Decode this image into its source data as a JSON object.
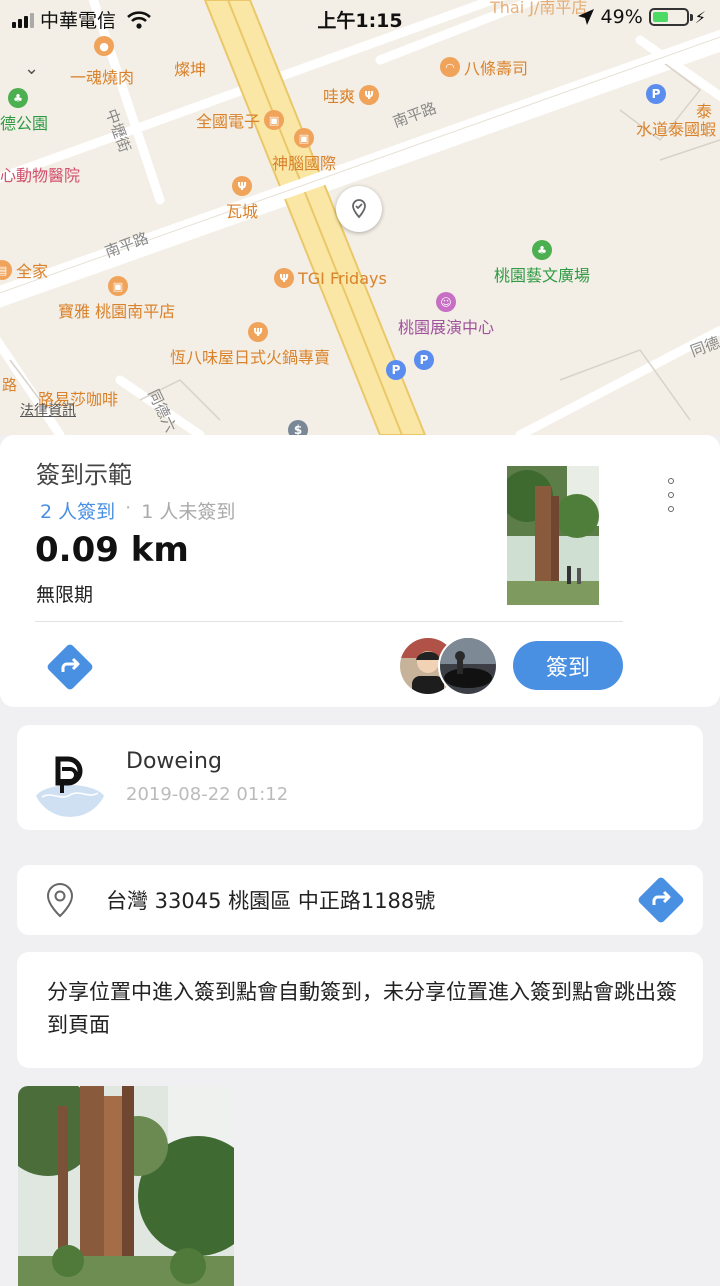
{
  "status_bar": {
    "carrier": "中華電信",
    "time": "上午1:15",
    "battery": "49%",
    "battery_level": 0.49
  },
  "map": {
    "pois": [
      {
        "name": "一魂燒肉",
        "color": "orange"
      },
      {
        "name": "燦坤",
        "color": "orange"
      },
      {
        "name": "八條壽司",
        "color": "orange"
      },
      {
        "name": "哇爽",
        "color": "orange"
      },
      {
        "name": "德公園",
        "color": "green"
      },
      {
        "name": "全國電子",
        "color": "orange"
      },
      {
        "name": "神腦國際",
        "color": "orange"
      },
      {
        "name": "心動物醫院",
        "color": "pink"
      },
      {
        "name": "瓦城",
        "color": "orange"
      },
      {
        "name": "全家",
        "color": "orange"
      },
      {
        "name": "TGI Fridays",
        "color": "orange"
      },
      {
        "name": "桃園藝文廣場",
        "color": "green"
      },
      {
        "name": "寶雅 桃園南平店",
        "color": "orange"
      },
      {
        "name": "桃園展演中心",
        "color": "purple"
      },
      {
        "name": "恆八味屋日式火鍋專賣",
        "color": "orange"
      },
      {
        "name": "路易莎咖啡",
        "color": "orange"
      },
      {
        "name": "水道泰國蝦",
        "color": "orange"
      },
      {
        "name": "泰",
        "color": "orange"
      },
      {
        "name": "Thai J/南平店",
        "color": "orange"
      }
    ],
    "roads": [
      "南平路",
      "南平路",
      "中壢街",
      "同德",
      "同德六",
      "路"
    ],
    "legal_label": "法律資訊"
  },
  "event": {
    "title": "簽到示範",
    "checked_in": "2 人簽到",
    "separator": "·",
    "not_checked_in": "1 人未簽到",
    "distance": "0.09 km",
    "validity": "無限期",
    "checkin_button": "簽到"
  },
  "creator": {
    "name": "Doweing",
    "timestamp": "2019-08-22 01:12"
  },
  "address": {
    "text": "台灣 33045 桃園區 中正路1188號"
  },
  "description": {
    "text": "分享位置中進入簽到點會自動簽到，未分享位置進入簽到點會跳出簽到頁面"
  },
  "icons": {
    "direction": "direction-icon",
    "location": "location-pin-icon",
    "more": "more-vertical-icon",
    "accent": "#4a90e2"
  }
}
